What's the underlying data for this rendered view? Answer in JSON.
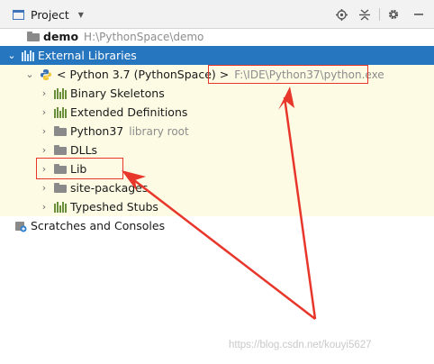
{
  "toolbar": {
    "title": "Project",
    "icons": [
      "target-icon",
      "collapse-icon",
      "gear-icon",
      "minimize-icon"
    ]
  },
  "tree": {
    "rows": [
      {
        "label": "demo",
        "sub": "H:\\PythonSpace\\demo",
        "bold": true
      },
      {
        "label": "External Libraries",
        "expanded": true
      },
      {
        "label": "< Python 3.7 (PythonSpace) >",
        "sub": "F:\\IDE\\Python37\\python.exe",
        "expanded": true
      },
      {
        "label": "Binary Skeletons"
      },
      {
        "label": "Extended Definitions"
      },
      {
        "label": "Python37",
        "sub": "library root"
      },
      {
        "label": "DLLs"
      },
      {
        "label": "Lib"
      },
      {
        "label": "site-packages"
      },
      {
        "label": "Typeshed Stubs"
      },
      {
        "label": "Scratches and Consoles"
      }
    ]
  },
  "colors": {
    "selection": "#2675bf",
    "highlight": "#fdfbe4",
    "annotation": "#e8362b"
  },
  "watermark": "https://blog.csdn.net/kouyi5627"
}
